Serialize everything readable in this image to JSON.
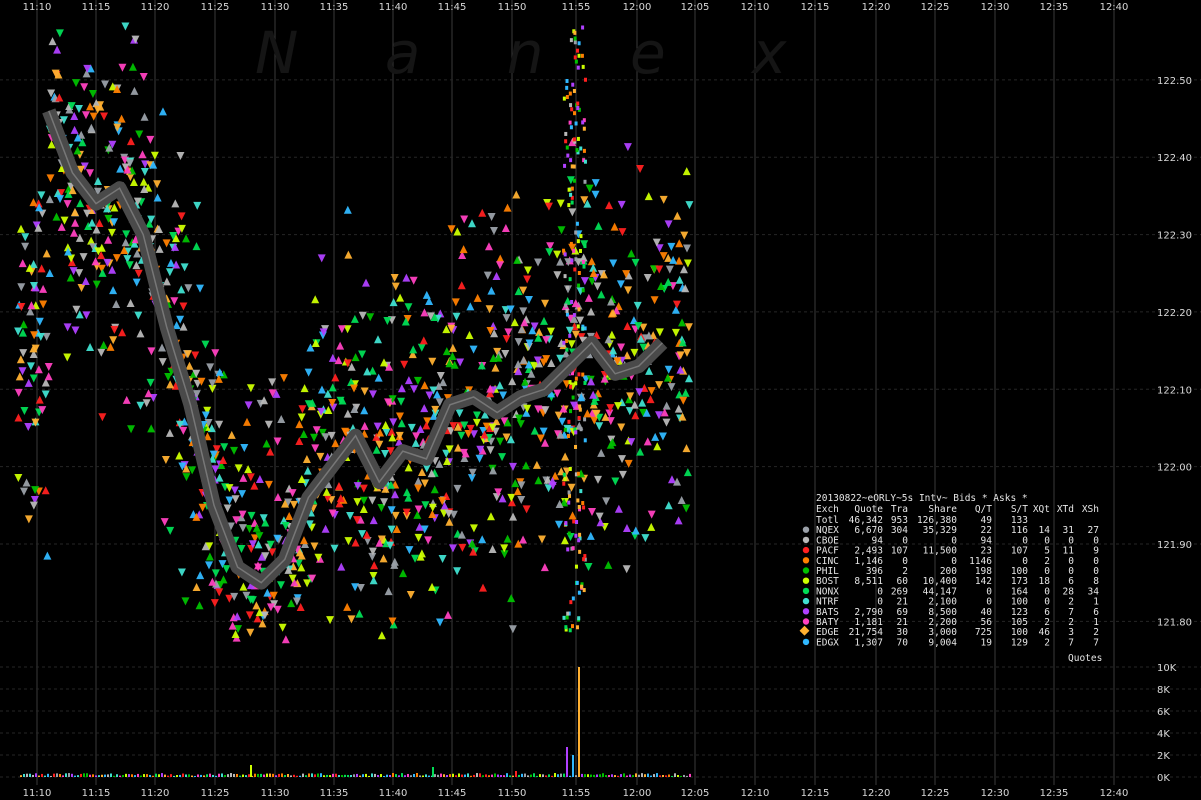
{
  "chart_data": {
    "type": "scatter",
    "watermark": "N a n e x",
    "x_tick_labels": [
      "11:10",
      "11:15",
      "11:20",
      "11:25",
      "11:30",
      "11:35",
      "11:40",
      "11:45",
      "11:50",
      "11:55",
      "12:00",
      "12:05",
      "12:10",
      "12:15",
      "12:20",
      "12:25",
      "12:30",
      "12:35",
      "12:40"
    ],
    "y_tick_labels": [
      "122.50",
      "122.40",
      "122.30",
      "122.20",
      "122.10",
      "122.00",
      "121.90",
      "121.80"
    ],
    "ylim": [
      121.75,
      122.58
    ],
    "volume_axis_labels": [
      "10K",
      "8K",
      "6K",
      "4K",
      "2K",
      "0K"
    ],
    "volume_ylim": [
      0,
      10000
    ],
    "legend_title": "20130822~eORLY~5s Intv~ Bids * Asks *",
    "table_header": [
      "Exch",
      "Quote",
      "Tra",
      "Share",
      "Q/T",
      "S/T",
      "XQt",
      "XTd",
      "XSh"
    ],
    "rows": [
      {
        "cells": [
          "Totl",
          "46,342",
          "953",
          "126,380",
          "49",
          "133",
          "",
          "",
          ""
        ],
        "color": ""
      },
      {
        "cells": [
          "NQEX",
          "6,670",
          "304",
          "35,329",
          "22",
          "116",
          "14",
          "31",
          "27"
        ],
        "color": "#9aa0a8"
      },
      {
        "cells": [
          "CBOE",
          "94",
          "0",
          "0",
          "94",
          "0",
          "0",
          "0",
          "0"
        ],
        "color": "#b8b8b8"
      },
      {
        "cells": [
          "PACF",
          "2,493",
          "107",
          "11,500",
          "23",
          "107",
          "5",
          "11",
          "9"
        ],
        "color": "#ff2020"
      },
      {
        "cells": [
          "CINC",
          "1,146",
          "0",
          "0",
          "1146",
          "0",
          "2",
          "0",
          "0"
        ],
        "color": "#ff7f00"
      },
      {
        "cells": [
          "PHIL",
          "396",
          "2",
          "200",
          "198",
          "100",
          "0",
          "0",
          "0"
        ],
        "color": "#00c000"
      },
      {
        "cells": [
          "BOST",
          "8,511",
          "60",
          "10,400",
          "142",
          "173",
          "18",
          "6",
          "8"
        ],
        "color": "#ccff00"
      },
      {
        "cells": [
          "NONX",
          "0",
          "269",
          "44,147",
          "0",
          "164",
          "0",
          "28",
          "34"
        ],
        "color": "#00dd55"
      },
      {
        "cells": [
          "NTRF",
          "0",
          "21",
          "2,100",
          "0",
          "100",
          "0",
          "2",
          "1"
        ],
        "color": "#40e0d0"
      },
      {
        "cells": [
          "BATS",
          "2,790",
          "69",
          "8,500",
          "40",
          "123",
          "6",
          "7",
          "6"
        ],
        "color": "#b040ff"
      },
      {
        "cells": [
          "BATY",
          "1,181",
          "21",
          "2,200",
          "56",
          "105",
          "2",
          "2",
          "1"
        ],
        "color": "#ff40c0"
      },
      {
        "cells": [
          "EDGE",
          "21,754",
          "30",
          "3,000",
          "725",
          "100",
          "46",
          "3",
          "2"
        ],
        "color": "#ffb030"
      },
      {
        "cells": [
          "EDGX",
          "1,307",
          "70",
          "9,004",
          "19",
          "129",
          "2",
          "7",
          "7"
        ],
        "color": "#30b8ff"
      }
    ],
    "footer_label": "Quotes",
    "price_path": [
      {
        "t": "11:11",
        "p": 122.46
      },
      {
        "t": "11:13",
        "p": 122.38
      },
      {
        "t": "11:15",
        "p": 122.34
      },
      {
        "t": "11:17",
        "p": 122.36
      },
      {
        "t": "11:19",
        "p": 122.3
      },
      {
        "t": "11:21",
        "p": 122.18
      },
      {
        "t": "11:23",
        "p": 122.08
      },
      {
        "t": "11:25",
        "p": 121.95
      },
      {
        "t": "11:27",
        "p": 121.87
      },
      {
        "t": "11:29",
        "p": 121.85
      },
      {
        "t": "11:31",
        "p": 121.88
      },
      {
        "t": "11:33",
        "p": 121.96
      },
      {
        "t": "11:35",
        "p": 122.0
      },
      {
        "t": "11:37",
        "p": 122.04
      },
      {
        "t": "11:39",
        "p": 121.98
      },
      {
        "t": "11:41",
        "p": 122.02
      },
      {
        "t": "11:43",
        "p": 122.01
      },
      {
        "t": "11:45",
        "p": 122.08
      },
      {
        "t": "11:47",
        "p": 122.09
      },
      {
        "t": "11:49",
        "p": 122.07
      },
      {
        "t": "11:51",
        "p": 122.09
      },
      {
        "t": "11:53",
        "p": 122.1
      },
      {
        "t": "11:55",
        "p": 122.13
      },
      {
        "t": "11:57",
        "p": 122.16
      },
      {
        "t": "11:59",
        "p": 122.12
      },
      {
        "t": "12:01",
        "p": 122.13
      },
      {
        "t": "12:03",
        "p": 122.16
      }
    ],
    "grid": true
  }
}
